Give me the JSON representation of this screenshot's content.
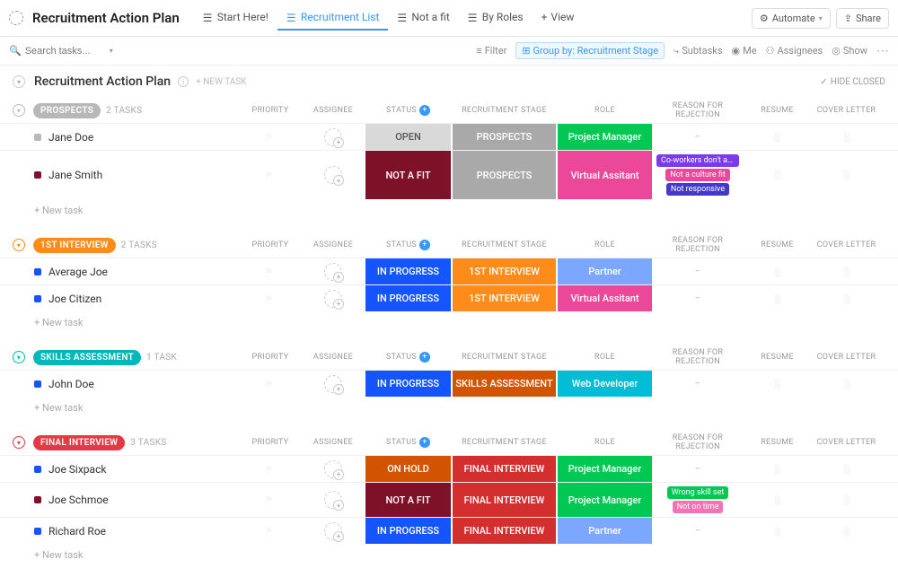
{
  "header": {
    "page_title": "Recruitment Action Plan",
    "views": [
      {
        "label": "Start Here!",
        "active": false
      },
      {
        "label": "Recruitment List",
        "active": true
      },
      {
        "label": "Not a fit",
        "active": false
      },
      {
        "label": "By Roles",
        "active": false
      },
      {
        "label": "View",
        "active": false,
        "is_add": true
      }
    ],
    "automate": "Automate",
    "share": "Share"
  },
  "toolbar": {
    "search_placeholder": "Search tasks...",
    "filter": "Filter",
    "group_by": "Group by: Recruitment Stage",
    "subtasks": "Subtasks",
    "me": "Me",
    "assignees": "Assignees",
    "show": "Show"
  },
  "list": {
    "title": "Recruitment Action Plan",
    "new_task_top": "+ NEW TASK",
    "hide_closed": "HIDE CLOSED",
    "new_task_row": "+ New task",
    "columns": {
      "priority": "PRIORITY",
      "assignee": "ASSIGNEE",
      "status": "STATUS",
      "stage": "RECRUITMENT STAGE",
      "role": "ROLE",
      "reason": "REASON FOR REJECTION",
      "resume": "RESUME",
      "cover": "COVER LETTER"
    }
  },
  "statuses": {
    "open": "OPEN",
    "notfit": "NOT A FIT",
    "inprog": "IN PROGRESS",
    "onhold": "ON HOLD"
  },
  "stages": {
    "prospects": "PROSPECTS",
    "first": "1ST INTERVIEW",
    "skills": "SKILLS ASSESSMENT",
    "final": "FINAL INTERVIEW"
  },
  "roles": {
    "pm": "Project Manager",
    "va": "Virtual Assitant",
    "partner": "Partner",
    "webdev": "Web Developer"
  },
  "tags": {
    "coworkers": "Co-workers don't appro...",
    "culture": "Not a culture fit",
    "nresp": "Not responsive",
    "wskill": "Wrong skill set",
    "ntime": "Not on time"
  },
  "groups": [
    {
      "id": "g0",
      "pill": "PROSPECTS",
      "pill_class": "stage-gray",
      "caret_class": "gc-gray",
      "count": "2 TASKS",
      "rows": [
        {
          "name": "Jane Doe",
          "dot": "dot-gray",
          "status": "open",
          "stage": "prospects",
          "role": "pm",
          "tags": []
        },
        {
          "name": "Jane Smith",
          "dot": "dot-maroon",
          "status": "notfit",
          "stage": "prospects",
          "role": "va",
          "tags": [
            "coworkers",
            "culture",
            "nresp"
          ]
        }
      ]
    },
    {
      "id": "g1",
      "pill": "1ST INTERVIEW",
      "pill_class": "stage-orange",
      "caret_class": "gc-orange",
      "count": "2 TASKS",
      "rows": [
        {
          "name": "Average Joe",
          "dot": "dot-blue",
          "status": "inprog",
          "stage": "first",
          "role": "partner",
          "tags": []
        },
        {
          "name": "Joe Citizen",
          "dot": "dot-blue",
          "status": "inprog",
          "stage": "first",
          "role": "va",
          "tags": []
        }
      ]
    },
    {
      "id": "g2",
      "pill": "SKILLS ASSESSMENT",
      "pill_class": "stage-teal",
      "caret_class": "gc-teal",
      "count": "1 TASK",
      "rows": [
        {
          "name": "John Doe",
          "dot": "dot-blue",
          "status": "inprog",
          "stage": "skills",
          "role": "webdev",
          "tags": []
        }
      ]
    },
    {
      "id": "g3",
      "pill": "FINAL INTERVIEW",
      "pill_class": "stage-red",
      "caret_class": "gc-red",
      "count": "3 TASKS",
      "rows": [
        {
          "name": "Joe Sixpack",
          "dot": "dot-blue",
          "status": "onhold",
          "stage": "final",
          "role": "pm",
          "tags": []
        },
        {
          "name": "Joe Schmoe",
          "dot": "dot-maroon",
          "status": "notfit",
          "stage": "final",
          "role": "pm",
          "tags": [
            "wskill",
            "ntime"
          ]
        },
        {
          "name": "Richard Roe",
          "dot": "dot-blue",
          "status": "inprog",
          "stage": "final",
          "role": "partner",
          "tags": []
        }
      ]
    }
  ]
}
